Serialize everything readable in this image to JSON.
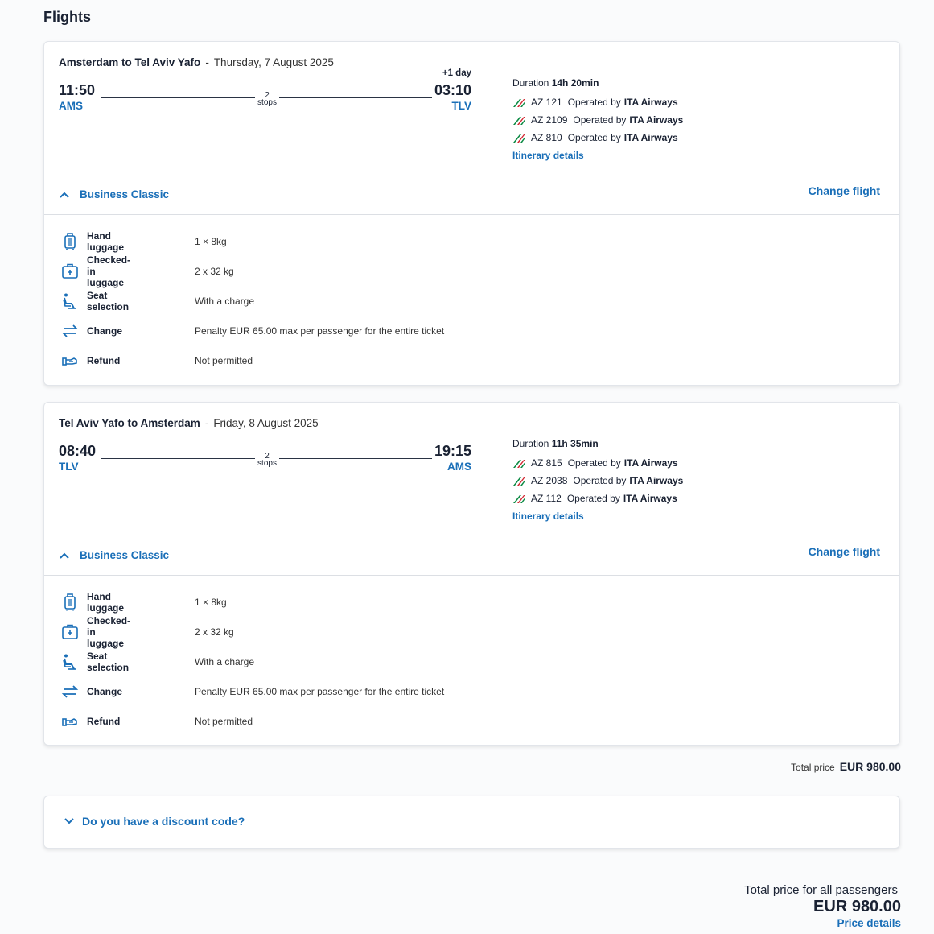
{
  "page": {
    "title": "Flights"
  },
  "flights": [
    {
      "route": "Amsterdam to Tel Aviv Yafo",
      "separator": "-",
      "date": "Thursday, 7 August 2025",
      "dep_time": "11:50",
      "dep_code": "AMS",
      "arr_time": "03:10",
      "arr_code": "TLV",
      "plus_day": "+1 day",
      "stops_count": "2",
      "stops_label": "stops",
      "duration_label": "Duration",
      "duration_value": "14h 20min",
      "segments": [
        {
          "code": "AZ 121",
          "operated": "Operated by",
          "carrier": "ITA Airways"
        },
        {
          "code": "AZ 2109",
          "operated": "Operated by",
          "carrier": "ITA Airways"
        },
        {
          "code": "AZ 810",
          "operated": "Operated by",
          "carrier": "ITA Airways"
        }
      ],
      "itinerary_link": "Itinerary details",
      "cabin": "Business Classic",
      "change_link": "Change flight",
      "features": [
        {
          "icon": "hand-luggage-icon",
          "name": "Hand luggage",
          "value": "1 × 8kg"
        },
        {
          "icon": "checked-luggage-icon",
          "name": "Checked-in luggage",
          "value": "2 x 32 kg"
        },
        {
          "icon": "seat-icon",
          "name": "Seat selection",
          "value": "With a charge"
        },
        {
          "icon": "change-icon",
          "name": "Change",
          "value": "Penalty EUR 65.00 max per passenger for the entire ticket"
        },
        {
          "icon": "refund-icon",
          "name": "Refund",
          "value": "Not permitted"
        }
      ]
    },
    {
      "route": "Tel Aviv Yafo to Amsterdam",
      "separator": "-",
      "date": "Friday, 8 August 2025",
      "dep_time": "08:40",
      "dep_code": "TLV",
      "arr_time": "19:15",
      "arr_code": "AMS",
      "plus_day": "",
      "stops_count": "2",
      "stops_label": "stops",
      "duration_label": "Duration",
      "duration_value": "11h 35min",
      "segments": [
        {
          "code": "AZ 815",
          "operated": "Operated by",
          "carrier": "ITA Airways"
        },
        {
          "code": "AZ 2038",
          "operated": "Operated by",
          "carrier": "ITA Airways"
        },
        {
          "code": "AZ 112",
          "operated": "Operated by",
          "carrier": "ITA Airways"
        }
      ],
      "itinerary_link": "Itinerary details",
      "cabin": "Business Classic",
      "change_link": "Change flight",
      "features": [
        {
          "icon": "hand-luggage-icon",
          "name": "Hand luggage",
          "value": "1 × 8kg"
        },
        {
          "icon": "checked-luggage-icon",
          "name": "Checked-in luggage",
          "value": "2 x 32 kg"
        },
        {
          "icon": "seat-icon",
          "name": "Seat selection",
          "value": "With a charge"
        },
        {
          "icon": "change-icon",
          "name": "Change",
          "value": "Penalty EUR 65.00 max per passenger for the entire ticket"
        },
        {
          "icon": "refund-icon",
          "name": "Refund",
          "value": "Not permitted"
        }
      ]
    }
  ],
  "total": {
    "label": "Total price",
    "value": "EUR 980.00"
  },
  "discount": {
    "label": "Do you have a discount code?"
  },
  "summary": {
    "label": "Total price for all passengers",
    "price": "EUR 980.00",
    "details_link": "Price details"
  },
  "colors": {
    "accent": "#1a6fb8",
    "text": "#1a2233",
    "itaGreen": "#0b8a43",
    "itaRed": "#d22630"
  }
}
